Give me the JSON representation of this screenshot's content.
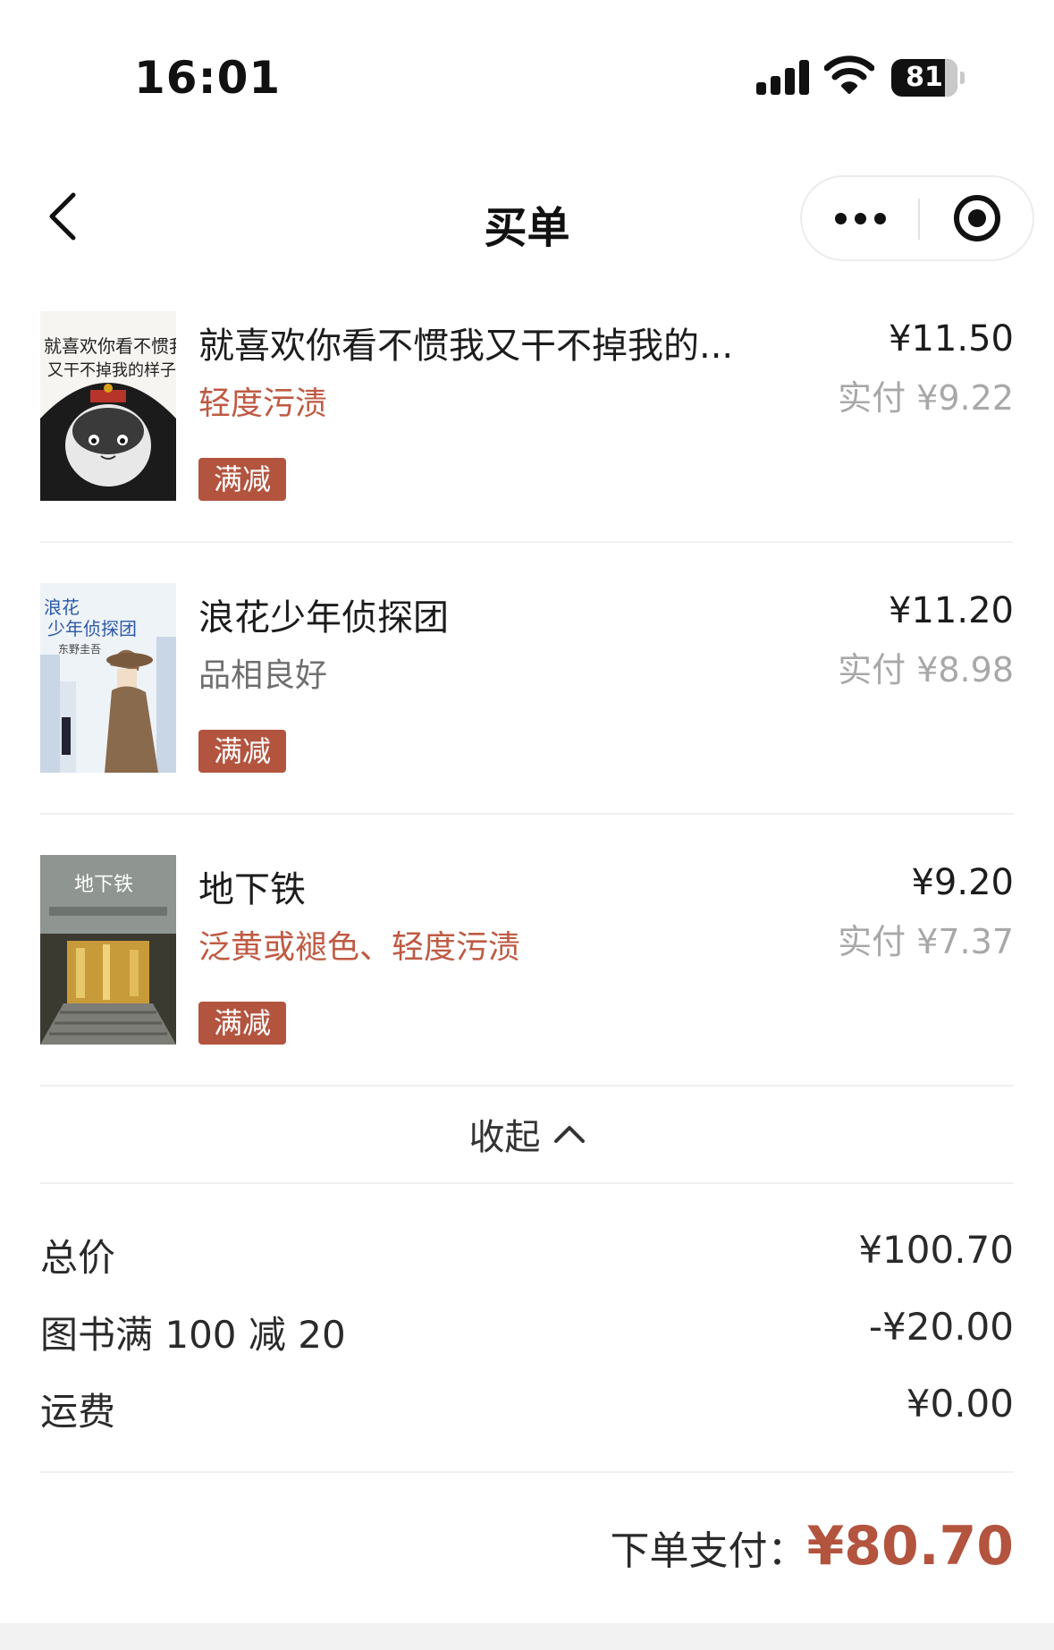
{
  "status_bar": {
    "time": "16:01",
    "battery": "81",
    "battery_level": 0.81
  },
  "nav": {
    "title": "买单"
  },
  "items": [
    {
      "title": "就喜欢你看不惯我又干不掉我的...",
      "condition": "轻度污渍",
      "condition_color": "#bf5a43",
      "tag": "满减",
      "price": "¥11.50",
      "paid": "实付 ¥9.22"
    },
    {
      "title": "浪花少年侦探团",
      "condition": "品相良好",
      "condition_color": "#6f6f6f",
      "tag": "满减",
      "price": "¥11.20",
      "paid": "实付 ¥8.98"
    },
    {
      "title": "地下铁",
      "condition": "泛黄或褪色、轻度污渍",
      "condition_color": "#bf5a43",
      "tag": "满减",
      "price": "¥9.20",
      "paid": "实付 ¥7.37"
    }
  ],
  "collapse": {
    "label": "收起"
  },
  "summary": {
    "total_price_label": "总价",
    "total_price_value": "¥100.70",
    "discount_label": "图书满 100 减 20",
    "discount_value": "-¥20.00",
    "shipping_label": "运费",
    "shipping_value": "¥0.00"
  },
  "payment": {
    "label": "下单支付：",
    "amount": "¥80.70"
  },
  "colors": {
    "accent": "#b3543f",
    "muted": "#a8a8a8"
  }
}
